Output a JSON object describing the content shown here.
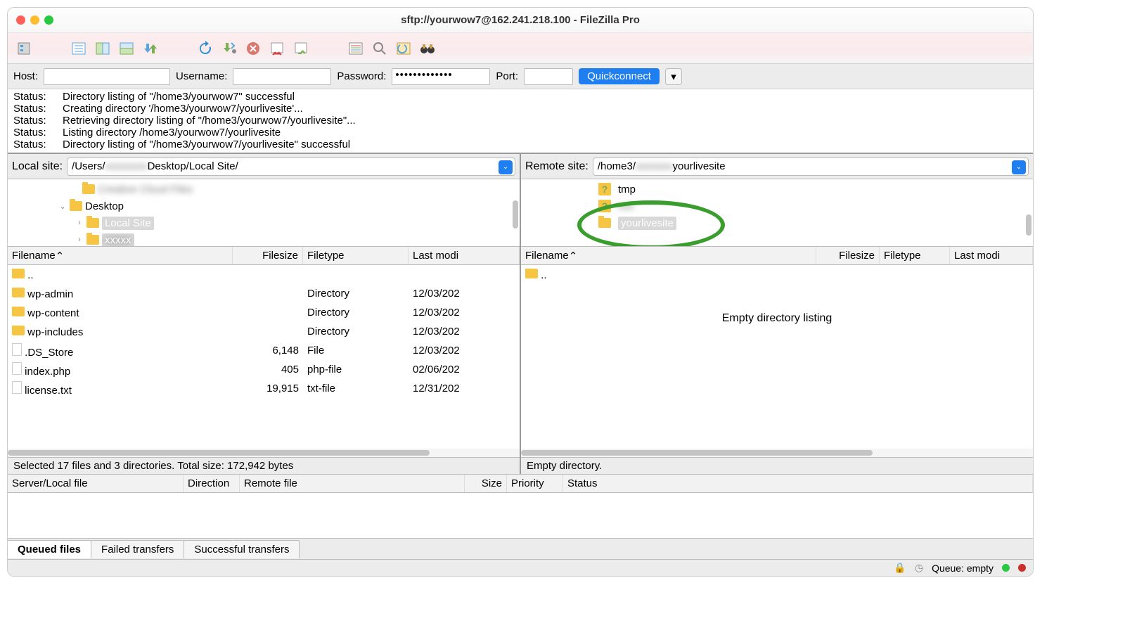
{
  "window": {
    "title": "sftp://yourwow7@162.241.218.100 - FileZilla Pro"
  },
  "quickconnect": {
    "host_label": "Host:",
    "host_value": "",
    "username_label": "Username:",
    "username_value": "",
    "password_label": "Password:",
    "password_value": "•••••••••••••",
    "port_label": "Port:",
    "port_value": "",
    "button": "Quickconnect"
  },
  "log": [
    {
      "label": "Status:",
      "msg": "Directory listing of \"/home3/yourwow7\" successful"
    },
    {
      "label": "Status:",
      "msg": "Creating directory '/home3/yourwow7/yourlivesite'..."
    },
    {
      "label": "Status:",
      "msg": "Retrieving directory listing of \"/home3/yourwow7/yourlivesite\"..."
    },
    {
      "label": "Status:",
      "msg": "Listing directory /home3/yourwow7/yourlivesite"
    },
    {
      "label": "Status:",
      "msg": "Directory listing of \"/home3/yourwow7/yourlivesite\" successful"
    }
  ],
  "local": {
    "site_label": "Local site:",
    "path_prefix": "/Users/",
    "path_mid": "xxxxxxxx",
    "path_suffix": "Desktop/Local Site/",
    "tree": {
      "row1": "Creative Cloud Files",
      "row2": "Desktop",
      "row3": "Local Site",
      "row4": "xxxxx"
    },
    "headers": {
      "name": "Filename",
      "size": "Filesize",
      "type": "Filetype",
      "mod": "Last modi"
    },
    "files": [
      {
        "icon": "folder",
        "name": "..",
        "size": "",
        "type": "",
        "mod": ""
      },
      {
        "icon": "folder",
        "name": "wp-admin",
        "size": "",
        "type": "Directory",
        "mod": "12/03/202"
      },
      {
        "icon": "folder",
        "name": "wp-content",
        "size": "",
        "type": "Directory",
        "mod": "12/03/202"
      },
      {
        "icon": "folder",
        "name": "wp-includes",
        "size": "",
        "type": "Directory",
        "mod": "12/03/202"
      },
      {
        "icon": "file",
        "name": ".DS_Store",
        "size": "6,148",
        "type": "File",
        "mod": "12/03/202"
      },
      {
        "icon": "file",
        "name": "index.php",
        "size": "405",
        "type": "php-file",
        "mod": "02/06/202"
      },
      {
        "icon": "file",
        "name": "license.txt",
        "size": "19,915",
        "type": "txt-file",
        "mod": "12/31/202"
      }
    ],
    "status": "Selected 17 files and 3 directories. Total size: 172,942 bytes"
  },
  "remote": {
    "site_label": "Remote site:",
    "path_prefix": "/home3/",
    "path_mid": "xxxxxxx",
    "path_suffix": "yourlivesite",
    "tree": {
      "row1": "tmp",
      "row2": "xxx",
      "row3": "yourlivesite"
    },
    "headers": {
      "name": "Filename",
      "size": "Filesize",
      "type": "Filetype",
      "mod": "Last modi"
    },
    "files": [
      {
        "icon": "folder",
        "name": "..",
        "size": "",
        "type": "",
        "mod": ""
      }
    ],
    "empty_message": "Empty directory listing",
    "status": "Empty directory."
  },
  "transfer_headers": {
    "server": "Server/Local file",
    "direction": "Direction",
    "remote": "Remote file",
    "size": "Size",
    "priority": "Priority",
    "status": "Status"
  },
  "tabs": {
    "queued": "Queued files",
    "failed": "Failed transfers",
    "success": "Successful transfers"
  },
  "bottom": {
    "queue": "Queue: empty"
  }
}
